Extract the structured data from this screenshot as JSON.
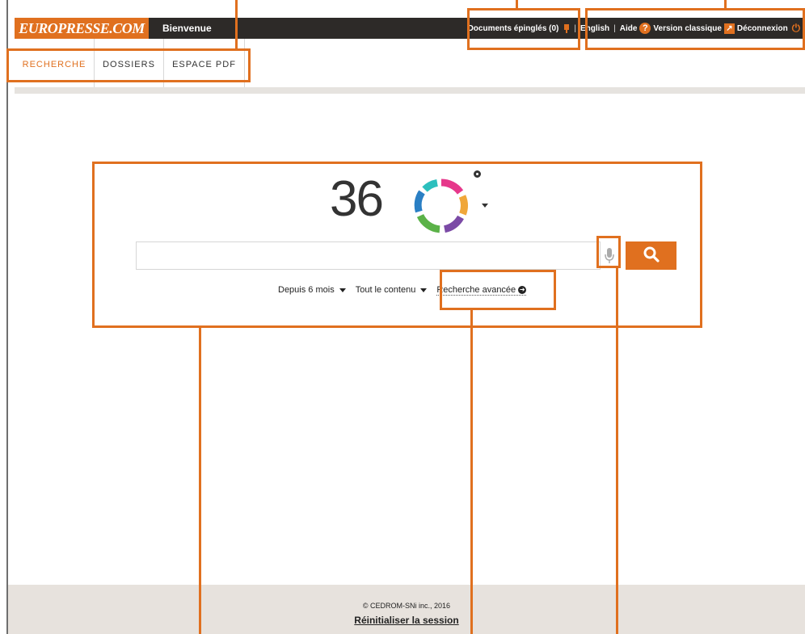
{
  "header": {
    "logo": "EUROPRESSE.COM",
    "welcome": "Bienvenue",
    "pinned": "Documents épinglés (0)",
    "english": "English",
    "help": "Aide",
    "classic": "Version classique",
    "logout": "Déconnexion",
    "separator": "|"
  },
  "nav": {
    "tabs": [
      {
        "label": "RECHERCHE",
        "active": true
      },
      {
        "label": "DOSSIERS",
        "active": false
      },
      {
        "label": "ESPACE PDF",
        "active": false
      }
    ]
  },
  "search": {
    "logo_text": "36",
    "query": "",
    "period": "Depuis 6 mois",
    "content": "Tout le contenu",
    "advanced": "Recherche avancée"
  },
  "footer": {
    "copyright": "© CEDROM-SNi inc., 2016",
    "reset": "Réinitialiser la session"
  },
  "colors": {
    "accent": "#e0701f",
    "topbar": "#2d2a28",
    "footer_bg": "#e7e2dd"
  },
  "icons": [
    "pin-icon",
    "help-icon",
    "external-link-icon",
    "power-icon",
    "microphone-icon",
    "search-icon",
    "chevron-down-icon",
    "arrow-right-circle-icon"
  ]
}
